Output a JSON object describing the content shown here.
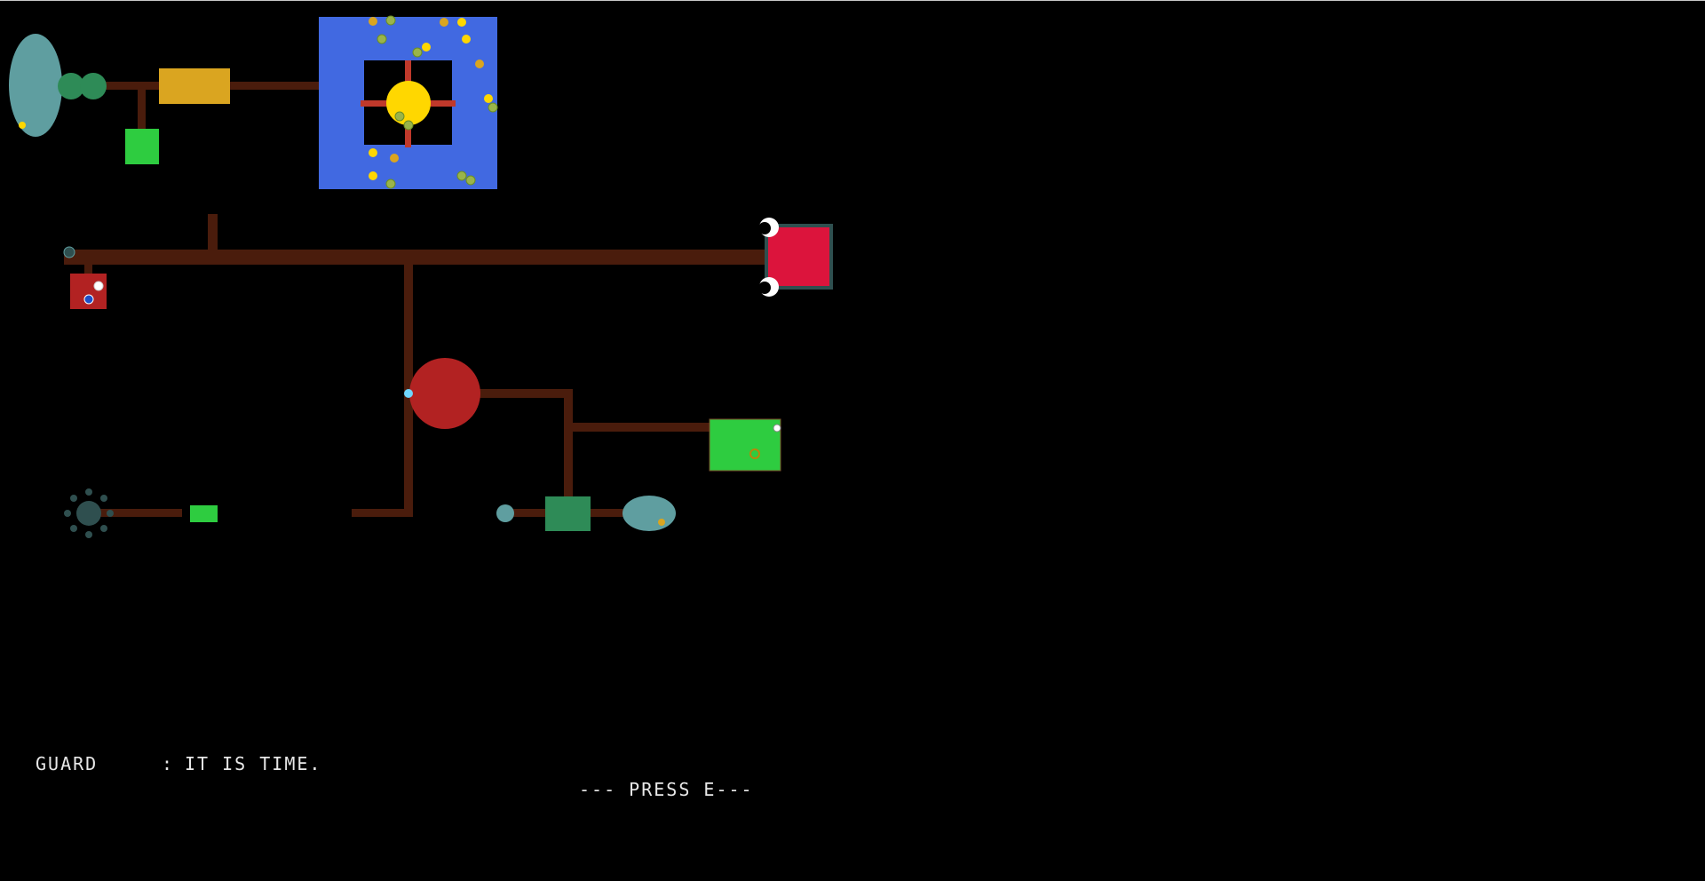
{
  "dialog": {
    "speaker": "GUARD",
    "separator": ":",
    "line": "IT IS TIME."
  },
  "prompt": "--- PRESS E---",
  "colors": {
    "background": "#000000",
    "pipe": "#4a1c0c",
    "pond": "#5f9ea0",
    "dark_green": "#2e8b57",
    "bright_green": "#2ecc40",
    "amber": "#daa520",
    "blue": "#4169e1",
    "sun": "#ffd700",
    "crimson": "#dc143c",
    "dark_red": "#b22222",
    "slate": "#2f4f4f",
    "spoke": "#c0392b"
  }
}
